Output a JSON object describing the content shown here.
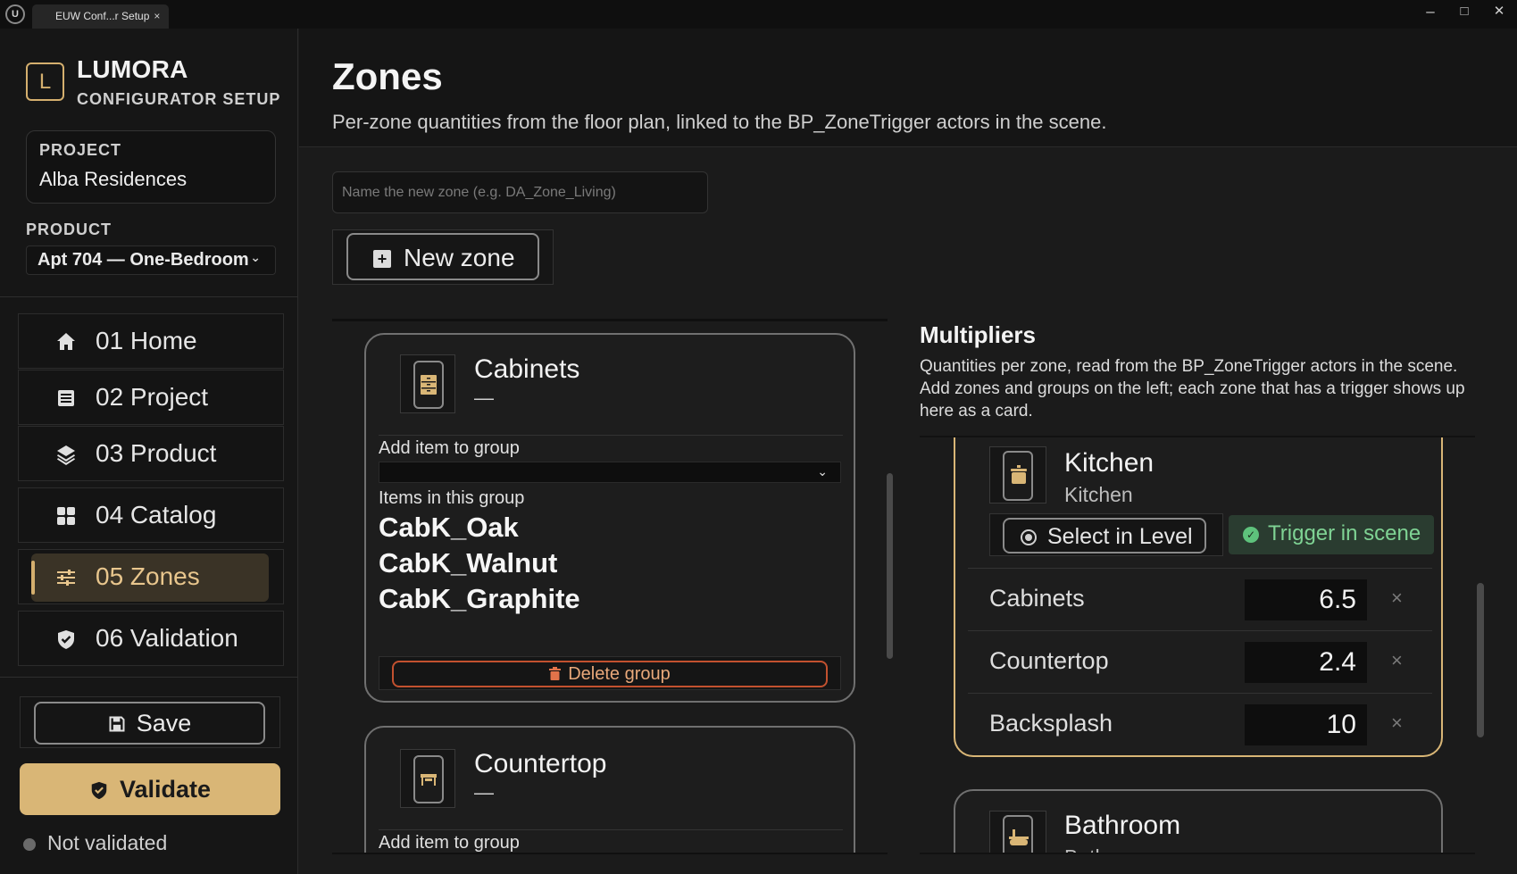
{
  "window": {
    "tab_title": "EUW Conf...r Setup",
    "tab_close": "×",
    "minimize": "–",
    "maximize": "□",
    "close": "✕"
  },
  "brand": {
    "icon_letter": "L",
    "name": "LUMORA",
    "subtitle": "CONFIGURATOR SETUP",
    "accent_color": "#d9b676"
  },
  "sidebar": {
    "project_label": "PROJECT",
    "project_value": "Alba Residences",
    "product_label": "PRODUCT",
    "product_value": "Apt 704 — One-Bedroom",
    "nav": [
      {
        "label": "01 Home",
        "icon": "home-icon",
        "active": false
      },
      {
        "label": "02 Project",
        "icon": "list-icon",
        "active": false
      },
      {
        "label": "03 Product",
        "icon": "layers-icon",
        "active": false
      },
      {
        "label": "04 Catalog",
        "icon": "grid-icon",
        "active": false
      },
      {
        "label": "05 Zones",
        "icon": "sliders-icon",
        "active": true
      },
      {
        "label": "06 Validation",
        "icon": "shield-check-icon",
        "active": false
      }
    ],
    "save_label": "Save",
    "validate_label": "Validate",
    "status_text": "Not validated"
  },
  "main": {
    "title": "Zones",
    "subtitle": "Per-zone quantities from the floor plan, linked to the BP_ZoneTrigger actors in the scene.",
    "new_zone_placeholder": "Name the new zone (e.g. DA_Zone_Living)",
    "new_zone_button": "New zone"
  },
  "groups": [
    {
      "name": "Cabinets",
      "dash": "—",
      "add_item_label": "Add item to group",
      "items_label": "Items in this group",
      "items": [
        "CabK_Oak",
        "CabK_Walnut",
        "CabK_Graphite"
      ],
      "delete_label": "Delete group"
    },
    {
      "name": "Countertop",
      "dash": "—",
      "add_item_label": "Add item to group"
    }
  ],
  "multipliers": {
    "title": "Multipliers",
    "description": "Quantities per zone, read from the BP_ZoneTrigger actors in the scene. Add zones and groups on the left; each zone that has a trigger shows up here as a card.",
    "zones": [
      {
        "name": "Kitchen",
        "subtitle": "Kitchen",
        "select_label": "Select in Level",
        "trigger_label": "Trigger in scene",
        "rows": [
          {
            "label": "Cabinets",
            "value": "6.5"
          },
          {
            "label": "Countertop",
            "value": "2.4"
          },
          {
            "label": "Backsplash",
            "value": "10"
          }
        ],
        "row_suffix": "×"
      },
      {
        "name": "Bathroom",
        "subtitle": "Bathroom"
      }
    ]
  }
}
